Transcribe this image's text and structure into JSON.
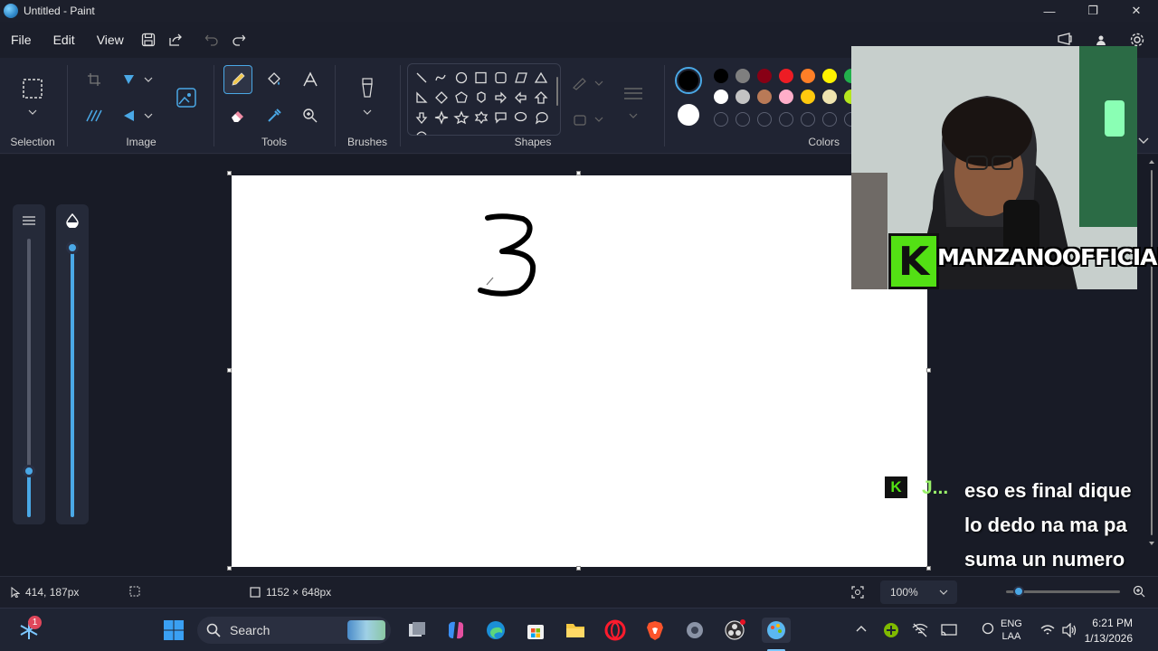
{
  "window": {
    "title": "Untitled - Paint",
    "minimize": "—",
    "maximize": "❐",
    "close": "✕"
  },
  "menu": {
    "file": "File",
    "edit": "Edit",
    "view": "View"
  },
  "ribbon": {
    "groups": {
      "selection": "Selection",
      "image": "Image",
      "tools": "Tools",
      "brushes": "Brushes",
      "shapes": "Shapes",
      "colors": "Colors"
    },
    "active_tool": "pencil",
    "primary_color": "#000000",
    "secondary_color": "#ffffff",
    "palette_row1": [
      "#000000",
      "#7f7f7f",
      "#880015",
      "#ed1c24",
      "#ff7f27",
      "#fff200",
      "#22b14c"
    ],
    "palette_row2": [
      "#ffffff",
      "#c3c3c3",
      "#b97a57",
      "#ffaec9",
      "#ffc90e",
      "#efe4b0",
      "#b5e61d"
    ]
  },
  "canvas": {
    "drawn_digit": "3"
  },
  "stream": {
    "channel_name": "MANZANOOFFICIAL",
    "badge": "K",
    "chat_user": "J...",
    "chat_message": "eso es final dique lo dedo na ma pa suma un numero"
  },
  "status": {
    "cursor_position": "414, 187px",
    "canvas_size": "1152 × 648px",
    "zoom": "100%"
  },
  "taskbar": {
    "search_placeholder": "Search",
    "notification_count": "1",
    "lang_top": "ENG",
    "lang_bottom": "LAA",
    "time": "6:21 PM",
    "date": "1/13/2026"
  }
}
